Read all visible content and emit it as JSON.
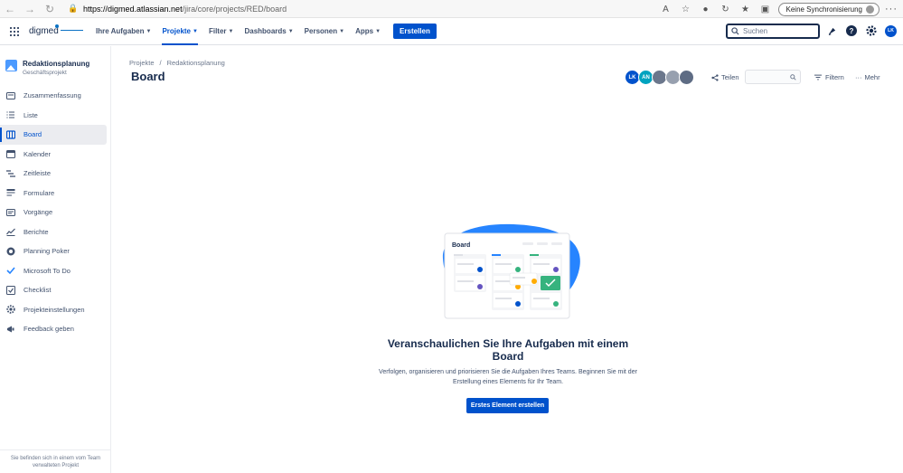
{
  "browser": {
    "url_host": "https://digmed.atlassian.net",
    "url_path": "/jira/core/projects/RED/board",
    "sync_label": "Keine Synchronisierung"
  },
  "topnav": {
    "logo_text": "digmed",
    "items": [
      {
        "label": "Ihre Aufgaben",
        "active": false
      },
      {
        "label": "Projekte",
        "active": true
      },
      {
        "label": "Filter",
        "active": false
      },
      {
        "label": "Dashboards",
        "active": false
      },
      {
        "label": "Personen",
        "active": false
      },
      {
        "label": "Apps",
        "active": false
      }
    ],
    "create_label": "Erstellen",
    "search_placeholder": "Suchen",
    "user_initials": "LK"
  },
  "sidebar": {
    "project_name": "Redaktionsplanung",
    "project_type": "Geschäftsprojekt",
    "items": [
      {
        "label": "Zusammenfassung",
        "icon": "summary-icon"
      },
      {
        "label": "Liste",
        "icon": "list-icon"
      },
      {
        "label": "Board",
        "icon": "board-icon",
        "active": true
      },
      {
        "label": "Kalender",
        "icon": "calendar-icon"
      },
      {
        "label": "Zeitleiste",
        "icon": "timeline-icon"
      },
      {
        "label": "Formulare",
        "icon": "forms-icon"
      },
      {
        "label": "Vorgänge",
        "icon": "issues-icon"
      },
      {
        "label": "Berichte",
        "icon": "reports-icon"
      },
      {
        "label": "Planning Poker",
        "icon": "poker-icon"
      },
      {
        "label": "Microsoft To Do",
        "icon": "todo-icon"
      },
      {
        "label": "Checklist",
        "icon": "checklist-icon"
      },
      {
        "label": "Projekteinstellungen",
        "icon": "settings-icon"
      },
      {
        "label": "Feedback geben",
        "icon": "megaphone-icon"
      }
    ],
    "footer": "Sie befinden sich in einem vom Team verwalteten Projekt"
  },
  "main": {
    "breadcrumb": [
      "Projekte",
      "/",
      "Redaktionsplanung"
    ],
    "title": "Board",
    "avatars": [
      {
        "initials": "LK",
        "color": "#0052cc"
      },
      {
        "initials": "AN",
        "color": "#00a3bf"
      },
      {
        "initials": "",
        "color": "#6b778c"
      },
      {
        "initials": "",
        "color": "#97a0af"
      },
      {
        "initials": "",
        "color": "#5e6c84"
      }
    ],
    "share_label": "Teilen",
    "filter_label": "Filtern",
    "more_label": "Mehr",
    "illustration_title": "Board",
    "empty_title": "Veranschaulichen Sie Ihre Aufgaben mit einem Board",
    "empty_desc": "Verfolgen, organisieren und priorisieren Sie die Aufgaben Ihres Teams. Beginnen Sie mit der Erstellung eines Elements für Ihr Team.",
    "cta_label": "Erstes Element erstellen"
  }
}
